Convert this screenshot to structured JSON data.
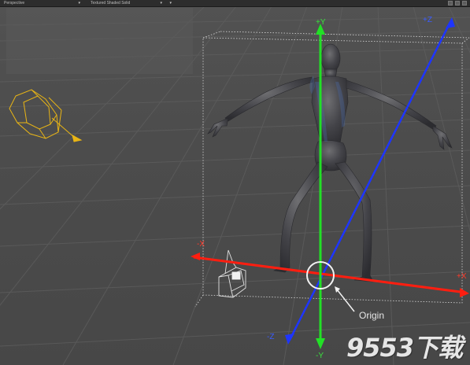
{
  "toolbar": {
    "view_mode": "Perspective",
    "shading_mode": "Textured Shaded Solid",
    "dropdown_arrow": "▾",
    "icons": [
      "display-options-icon",
      "maximize-icon",
      "expand-icon"
    ]
  },
  "axes": {
    "y_pos": "+Y",
    "y_neg": "-Y",
    "z_pos": "+Z",
    "z_neg": "-Z",
    "x_pos": "+X",
    "x_neg": "-X"
  },
  "origin_label": "Origin",
  "watermark": "9553下载",
  "colors": {
    "y_axis": "#22e026",
    "z_axis": "#1e35ff",
    "x_axis": "#ff1e10",
    "camera": "#e9b515",
    "light": "#dedede",
    "grid": "#5d5d5d",
    "background": "#4d4d4d"
  }
}
